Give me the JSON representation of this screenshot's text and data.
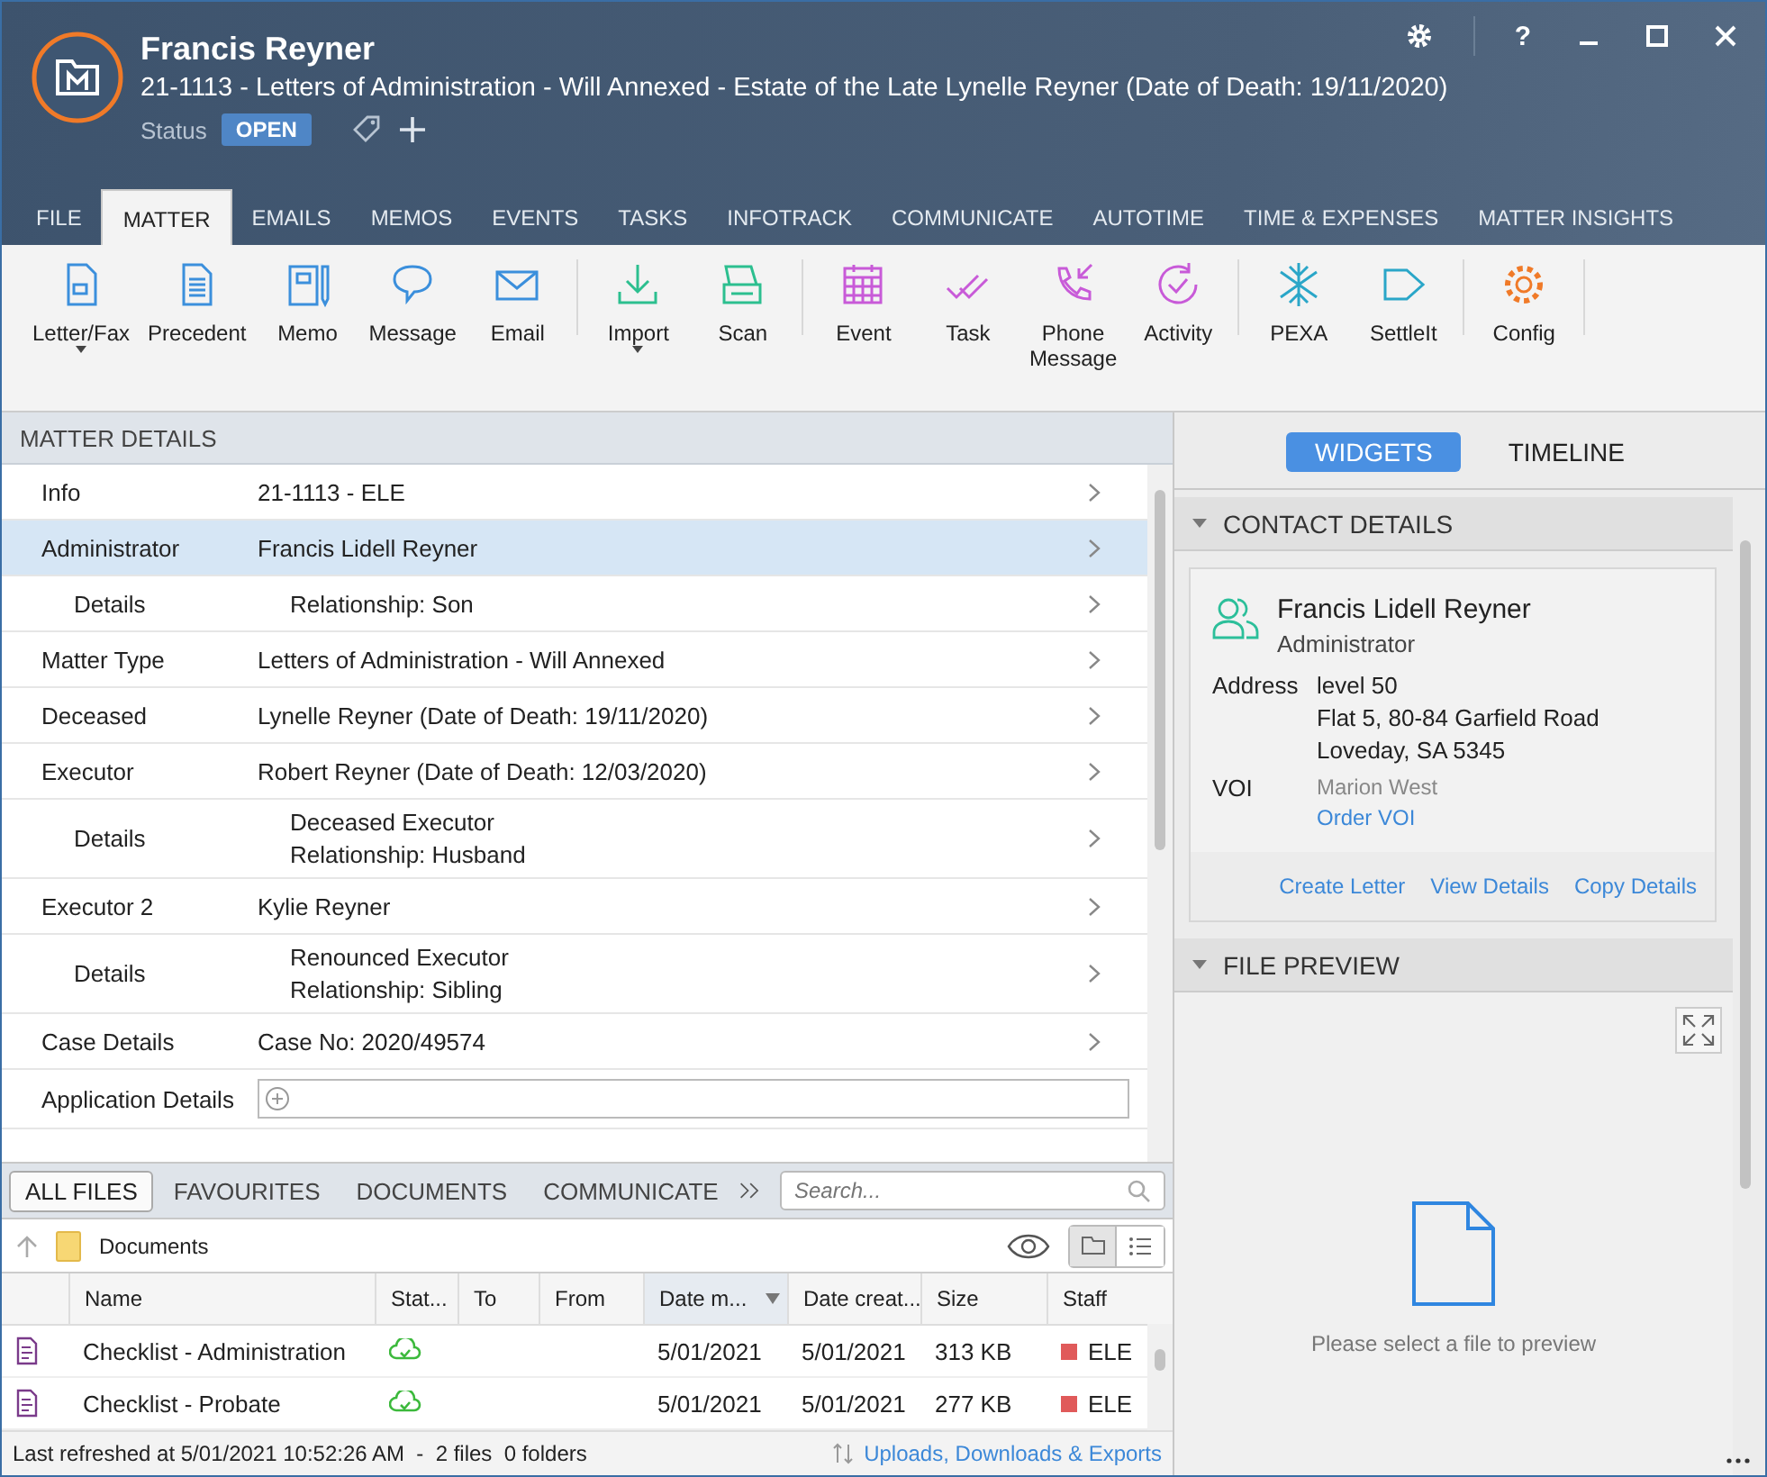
{
  "header": {
    "title": "Francis Reyner",
    "subtitle": "21-1113 - Letters of Administration - Will Annexed - Estate of the Late Lynelle Reyner (Date of Death: 19/11/2020)",
    "status_label": "Status",
    "status": "OPEN"
  },
  "window_controls": [
    "?"
  ],
  "tabs": [
    {
      "label": "FILE",
      "selected": false
    },
    {
      "label": "MATTER",
      "selected": true
    },
    {
      "label": "EMAILS",
      "selected": false
    },
    {
      "label": "MEMOS",
      "selected": false
    },
    {
      "label": "EVENTS",
      "selected": false
    },
    {
      "label": "TASKS",
      "selected": false
    },
    {
      "label": "INFOTRACK",
      "selected": false
    },
    {
      "label": "COMMUNICATE",
      "selected": false
    },
    {
      "label": "AUTOTIME",
      "selected": false
    },
    {
      "label": "TIME & EXPENSES",
      "selected": false
    },
    {
      "label": "MATTER INSIGHTS",
      "selected": false
    }
  ],
  "ribbon": [
    {
      "items": [
        {
          "label": "Letter/Fax",
          "dropdown": true
        },
        {
          "label": "Precedent",
          "dropdown": false
        },
        {
          "label": "Memo",
          "dropdown": false
        },
        {
          "label": "Message",
          "dropdown": false
        },
        {
          "label": "Email",
          "dropdown": false
        }
      ]
    },
    {
      "items": [
        {
          "label": "Import",
          "dropdown": true
        },
        {
          "label": "Scan",
          "dropdown": false
        }
      ]
    },
    {
      "items": [
        {
          "label": "Event",
          "dropdown": false
        },
        {
          "label": "Task",
          "dropdown": false
        },
        {
          "label": "Phone Message",
          "dropdown": false
        },
        {
          "label": "Activity",
          "dropdown": false
        }
      ]
    },
    {
      "items": [
        {
          "label": "PEXA",
          "dropdown": false
        },
        {
          "label": "SettleIt",
          "dropdown": false
        }
      ]
    },
    {
      "items": [
        {
          "label": "Config",
          "dropdown": false
        }
      ]
    }
  ],
  "matter_details": {
    "title": "MATTER DETAILS",
    "rows": [
      {
        "label": "Info",
        "kind": "link",
        "lines": [
          "21-1113 - ELE"
        ],
        "selected": false
      },
      {
        "label": "Administrator",
        "kind": "link",
        "lines": [
          "Francis Lidell Reyner"
        ],
        "selected": true,
        "children": [
          {
            "label": "Details",
            "kind": "link",
            "lines": [
              "Relationship: Son"
            ],
            "selected": false
          }
        ]
      },
      {
        "label": "Matter Type",
        "kind": "link",
        "lines": [
          "Letters of Administration - Will Annexed"
        ],
        "selected": false
      },
      {
        "label": "Deceased",
        "kind": "link",
        "lines": [
          "Lynelle Reyner (Date of Death: 19/11/2020)"
        ],
        "selected": false
      },
      {
        "label": "Executor",
        "kind": "link",
        "lines": [
          "Robert Reyner (Date of Death: 12/03/2020)"
        ],
        "selected": false,
        "children": [
          {
            "label": "Details",
            "kind": "link",
            "lines": [
              "Deceased Executor",
              "Relationship: Husband"
            ],
            "selected": false
          }
        ]
      },
      {
        "label": "Executor 2",
        "kind": "link",
        "lines": [
          "Kylie Reyner"
        ],
        "selected": false,
        "children": [
          {
            "label": "Details",
            "kind": "link",
            "lines": [
              "Renounced Executor",
              "Relationship: Sibling"
            ],
            "selected": false
          }
        ]
      },
      {
        "label": "Case Details",
        "kind": "link",
        "lines": [
          "Case No: 2020/49574"
        ],
        "selected": false
      },
      {
        "label": "Application Details",
        "kind": "input",
        "lines": [],
        "selected": false
      }
    ]
  },
  "file_tabs": [
    {
      "label": "ALL FILES",
      "selected": true
    },
    {
      "label": "FAVOURITES",
      "selected": false
    },
    {
      "label": "DOCUMENTS",
      "selected": false
    },
    {
      "label": "COMMUNICATE",
      "selected": false
    }
  ],
  "file_search": {
    "placeholder": "Search..."
  },
  "folder": "Documents",
  "files": {
    "columns": [
      {
        "label": "Name",
        "sorted": false
      },
      {
        "label": "Stat...",
        "sorted": false
      },
      {
        "label": "To",
        "sorted": false
      },
      {
        "label": "From",
        "sorted": false
      },
      {
        "label": "Date m...",
        "sorted": true
      },
      {
        "label": "Date creat...",
        "sorted": false
      },
      {
        "label": "Size",
        "sorted": false
      },
      {
        "label": "Staff",
        "sorted": false
      }
    ],
    "rows": [
      {
        "name": "Checklist - Administration",
        "to": "",
        "from": "",
        "modified": "5/01/2021",
        "created": "5/01/2021",
        "size": "313 KB",
        "staff": "ELE",
        "color": "#e05a5a"
      },
      {
        "name": "Checklist - Probate",
        "to": "",
        "from": "",
        "modified": "5/01/2021",
        "created": "5/01/2021",
        "size": "277 KB",
        "staff": "ELE",
        "color": "#e05a5a"
      }
    ]
  },
  "status_bar": {
    "refreshed": "Last refreshed at 5/01/2021 10:52:26 AM  -  2 files  0 folders",
    "link": "Uploads, Downloads & Exports"
  },
  "right_tabs": [
    {
      "label": "WIDGETS",
      "selected": true
    },
    {
      "label": "TIMELINE",
      "selected": false
    }
  ],
  "contact": {
    "section": "CONTACT DETAILS",
    "expanded": true,
    "name": "Francis Lidell Reyner",
    "role": "Administrator",
    "address_label": "Address",
    "address": [
      "level 50",
      "Flat 5, 80-84 Garfield Road",
      "Loveday, SA 5345"
    ],
    "voi_label": "VOI",
    "voi": "Marion West",
    "voi_link": "Order VOI",
    "actions": [
      "Create Letter",
      "View Details",
      "Copy Details"
    ]
  },
  "preview": {
    "section": "FILE PREVIEW",
    "expanded": true,
    "message": "Please select a file to preview"
  }
}
